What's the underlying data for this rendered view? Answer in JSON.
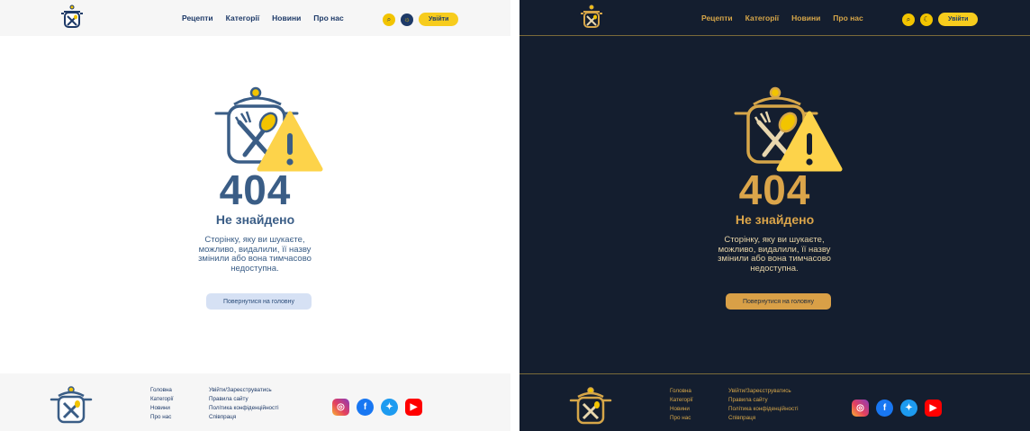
{
  "nav": {
    "items": [
      "Рецепти",
      "Категорії",
      "Новини",
      "Про нас"
    ],
    "login_label": "Увійти",
    "icons": [
      "search-icon",
      "sun-icon",
      "moon-icon"
    ]
  },
  "error": {
    "code": "404",
    "title": "Не знайдено",
    "description": "Сторінку, яку ви шукаєте, можливо, видалили, її назву змінили або вона тимчасово недоступна.",
    "back_label": "Повернутися на головну"
  },
  "footer": {
    "col1": [
      "Головна",
      "Категорії",
      "Новини",
      "Про нас"
    ],
    "col2": [
      "Увійти/Зареєструватись",
      "Правила сайту",
      "Політика конфіденційності",
      "Співпраця"
    ],
    "social": [
      "instagram-icon",
      "facebook-icon",
      "twitter-icon",
      "youtube-icon"
    ]
  },
  "themes": {
    "light": {
      "bg": "#ffffff",
      "text": "#3a5d86",
      "accent": "#f7cc1d"
    },
    "dark": {
      "bg": "#141e2f",
      "text": "#dba54a",
      "accent": "#f7cc1d"
    }
  }
}
